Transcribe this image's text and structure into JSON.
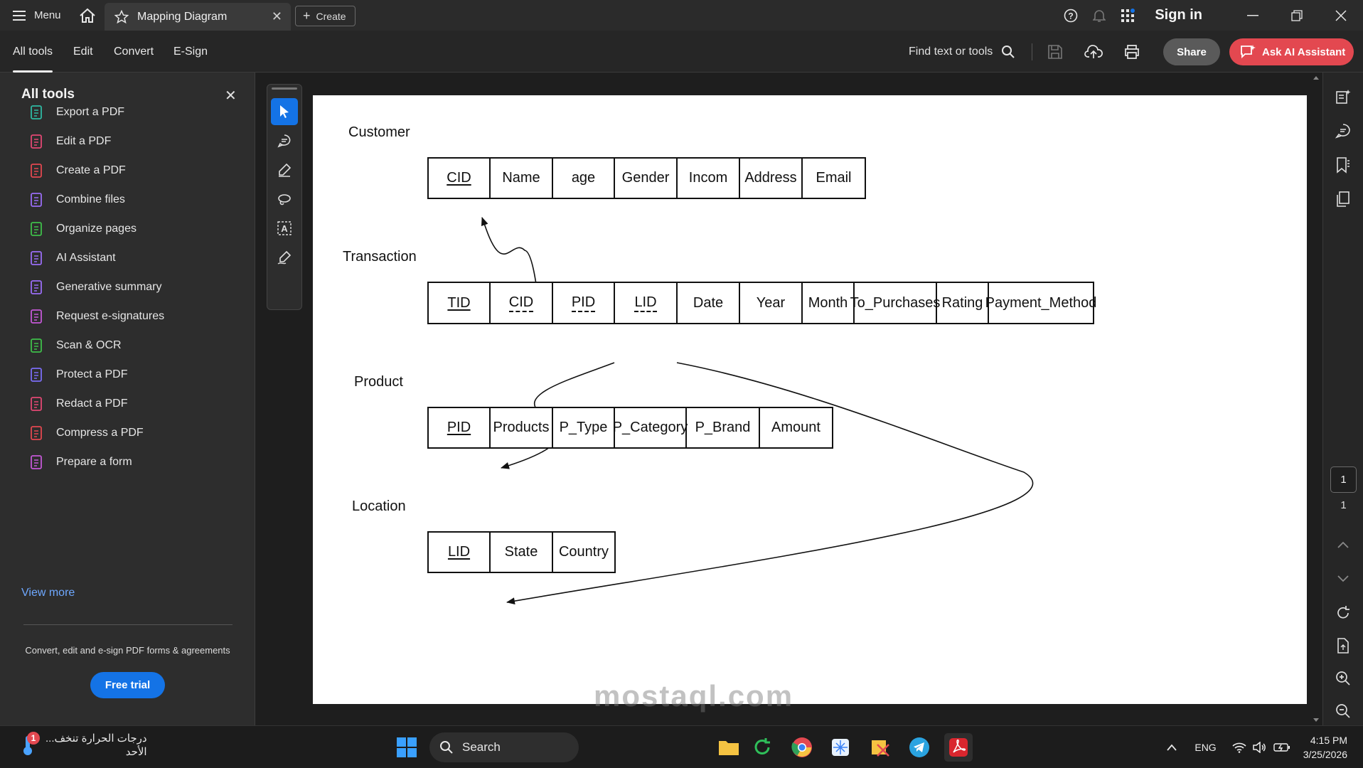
{
  "titlebar": {
    "menu_label": "Menu",
    "tab_title": "Mapping Diagram",
    "create_label": "Create",
    "signin_label": "Sign in"
  },
  "toolbar": {
    "tabs": [
      "All tools",
      "Edit",
      "Convert",
      "E-Sign"
    ],
    "find_label": "Find text or tools",
    "share_label": "Share",
    "ai_label": "Ask AI Assistant"
  },
  "left_panel": {
    "title": "All tools",
    "items": [
      {
        "label": "Export a PDF",
        "icon": "export-pdf-icon",
        "color": "#2fb9a3"
      },
      {
        "label": "Edit a PDF",
        "icon": "edit-pdf-icon",
        "color": "#e34874"
      },
      {
        "label": "Create a PDF",
        "icon": "create-pdf-icon",
        "color": "#e34850"
      },
      {
        "label": "Combine files",
        "icon": "combine-files-icon",
        "color": "#9a6df5"
      },
      {
        "label": "Organize pages",
        "icon": "organize-pages-icon",
        "color": "#3fbf4a"
      },
      {
        "label": "AI Assistant",
        "icon": "ai-assistant-icon",
        "color": "#9a6df5"
      },
      {
        "label": "Generative summary",
        "icon": "generative-summary-icon",
        "color": "#9a6df5"
      },
      {
        "label": "Request e-signatures",
        "icon": "request-esignatures-icon",
        "color": "#c458d6"
      },
      {
        "label": "Scan & OCR",
        "icon": "scan-ocr-icon",
        "color": "#3fbf4a"
      },
      {
        "label": "Protect a PDF",
        "icon": "protect-pdf-icon",
        "color": "#7b6df5"
      },
      {
        "label": "Redact a PDF",
        "icon": "redact-pdf-icon",
        "color": "#e34874"
      },
      {
        "label": "Compress a PDF",
        "icon": "compress-pdf-icon",
        "color": "#e34850"
      },
      {
        "label": "Prepare a form",
        "icon": "prepare-form-icon",
        "color": "#c458d6"
      }
    ],
    "view_more": "View more",
    "promo_text": "Convert, edit and e-sign PDF forms & agreements",
    "free_trial": "Free trial"
  },
  "diagram": {
    "entities": [
      {
        "name": "Customer",
        "columns": [
          {
            "text": "CID",
            "key": "pk"
          },
          {
            "text": "Name"
          },
          {
            "text": "age"
          },
          {
            "text": "Gender"
          },
          {
            "text": "Incom"
          },
          {
            "text": "Address"
          },
          {
            "text": "Email"
          }
        ]
      },
      {
        "name": "Transaction",
        "columns": [
          {
            "text": "TID",
            "key": "pk"
          },
          {
            "text": "CID",
            "key": "fk"
          },
          {
            "text": "PID",
            "key": "fk"
          },
          {
            "text": "LID",
            "key": "fk"
          },
          {
            "text": "Date"
          },
          {
            "text": "Year"
          },
          {
            "text": "Month"
          },
          {
            "text": "To_Purchases"
          },
          {
            "text": "Rating"
          },
          {
            "text": "Payment_Method"
          }
        ]
      },
      {
        "name": "Product",
        "columns": [
          {
            "text": "PID",
            "key": "pk"
          },
          {
            "text": "Products"
          },
          {
            "text": "P_Type"
          },
          {
            "text": "P_Category"
          },
          {
            "text": "P_Brand"
          },
          {
            "text": "Amount"
          }
        ]
      },
      {
        "name": "Location",
        "columns": [
          {
            "text": "LID",
            "key": "pk"
          },
          {
            "text": "State"
          },
          {
            "text": "Country"
          }
        ]
      }
    ]
  },
  "right_rail": {
    "current_page": "1",
    "total_pages": "1"
  },
  "taskbar": {
    "weather_line1": "درجات الحرارة تنخف...",
    "weather_line2": "الأحد",
    "notification_count": "1",
    "search_label": "Search",
    "language": "ENG",
    "time": "4:15 PM",
    "date": "3/25/2026"
  },
  "watermark": "mostaql.com"
}
